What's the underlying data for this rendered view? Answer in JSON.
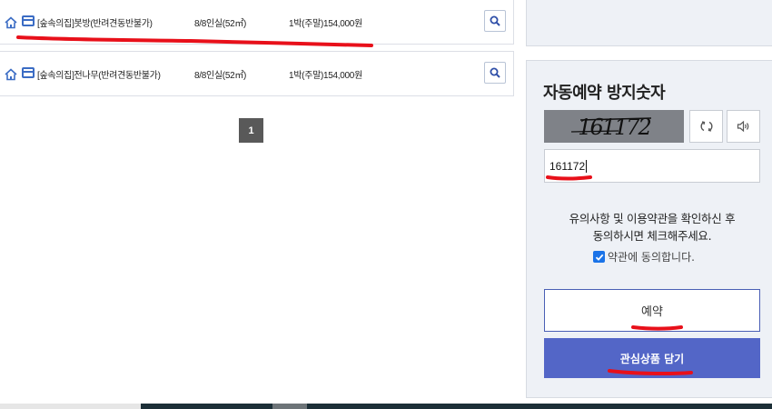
{
  "rooms": [
    {
      "name": "[숲속의집]봇방(반려견동반불가)",
      "capacity": "8/8인실(52㎡)",
      "price": "1박(주말)154,000원"
    },
    {
      "name": "[숲속의집]전나무(반려견동반불가)",
      "capacity": "8/8인실(52㎡)",
      "price": "1박(주말)154,000원"
    }
  ],
  "pagination": {
    "current": "1"
  },
  "booking": {
    "title": "자동예약 방지숫자",
    "captcha_text": "161172",
    "captcha_input": "161172",
    "notice_line1": "유의사항 및 이용약관을 확인하신 후",
    "notice_line2": "동의하시면 체크해주세요.",
    "agree_label": "약관에 동의합니다.",
    "agree_checked": true,
    "reserve_label": "예약",
    "wishlist_label": "관심상품 담기"
  },
  "colors": {
    "accent": "#5366c7",
    "panel_bg": "#eef1f6",
    "annotation": "#e8101a"
  },
  "icons": [
    "home-icon",
    "card-icon",
    "search-icon",
    "refresh-icon",
    "speaker-icon",
    "check-icon"
  ]
}
